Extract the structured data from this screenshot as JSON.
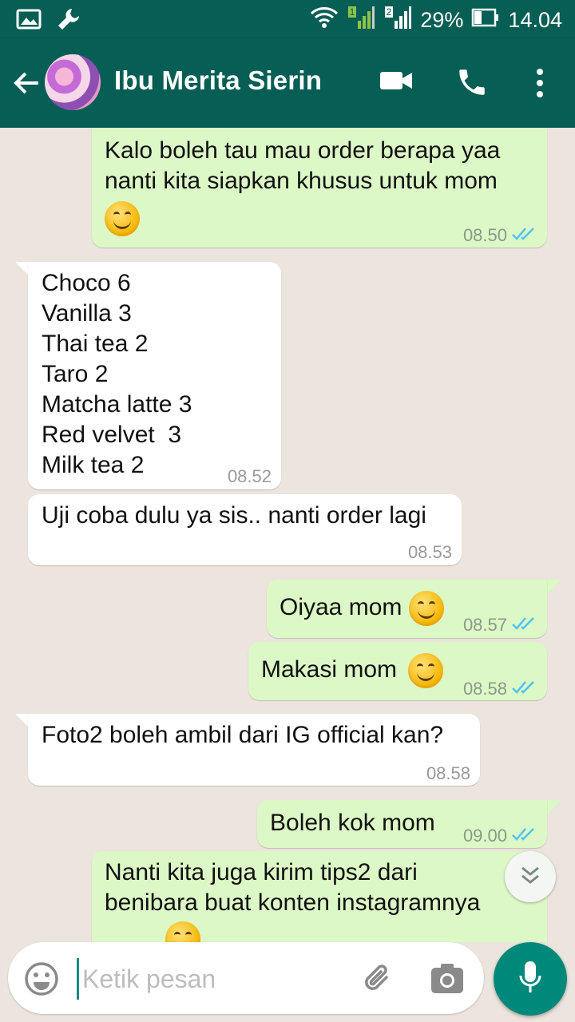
{
  "status_bar": {
    "battery": "29%",
    "time": "14.04",
    "sim1": "1",
    "sim2": "2"
  },
  "header": {
    "contact_name": "Ibu Merita Sierin"
  },
  "messages": [
    {
      "direction": "out",
      "text": "Kalo boleh tau mau order berapa yaa\nnanti kita siapkan khusus untuk mom",
      "emoji": true,
      "time": "08.50"
    },
    {
      "direction": "in",
      "text": "Choco 6\nVanilla 3\nThai tea 2\nTaro 2\nMatcha latte 3\nRed velvet  3\nMilk tea 2",
      "time": "08.52"
    },
    {
      "direction": "in",
      "text": "Uji coba dulu ya sis.. nanti order lagi",
      "time": "08.53"
    },
    {
      "direction": "out",
      "text": "Oiyaa mom",
      "emoji": true,
      "time": "08.57"
    },
    {
      "direction": "out",
      "text": "Makasi mom",
      "emoji": true,
      "time": "08.58"
    },
    {
      "direction": "in",
      "text": "Foto2 boleh ambil dari IG official kan?",
      "time": "08.58"
    },
    {
      "direction": "out",
      "text": "Boleh kok mom",
      "time": "09.00"
    },
    {
      "direction": "out",
      "text": "Nanti kita juga kirim tips2 dari\nbenibara buat konten instagramnya",
      "emoji": true
    }
  ],
  "composer": {
    "placeholder": "Ketik pesan"
  },
  "colors": {
    "header": "#075e54",
    "outgoing_bubble": "#dcf8c6",
    "incoming_bubble": "#ffffff",
    "read_ticks": "#4fc3f7",
    "mic_button": "#00897b"
  }
}
